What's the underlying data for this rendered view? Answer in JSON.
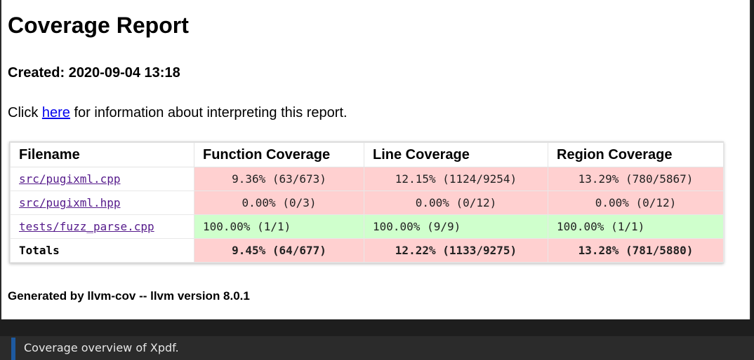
{
  "report": {
    "title": "Coverage Report",
    "created": "Created: 2020-09-04 13:18",
    "info_prefix": "Click ",
    "info_link": "here",
    "info_suffix": " for information about interpreting this report.",
    "footer": "Generated by llvm-cov -- llvm version 8.0.1"
  },
  "table": {
    "headers": [
      "Filename",
      "Function Coverage",
      "Line Coverage",
      "Region Coverage"
    ],
    "rows": [
      {
        "file": "src/pugixml.cpp",
        "function": "9.36% (63/673)",
        "line": "12.15% (1124/9254)",
        "region": "13.29% (780/5867)",
        "status": "low"
      },
      {
        "file": "src/pugixml.hpp",
        "function": "0.00% (0/3)",
        "line": "0.00% (0/12)",
        "region": "0.00% (0/12)",
        "status": "low"
      },
      {
        "file": "tests/fuzz_parse.cpp",
        "function": "100.00% (1/1)",
        "line": "100.00% (9/9)",
        "region": "100.00% (1/1)",
        "status": "full"
      }
    ],
    "totals": {
      "label": "Totals",
      "function": "9.45% (64/677)",
      "line": "12.22% (1133/9275)",
      "region": "13.28% (781/5880)"
    }
  },
  "colors": {
    "low_coverage": "#ffd0d0",
    "full_coverage": "#cfffcc",
    "link": "#0000ee",
    "visited_link": "#551a8b"
  },
  "caption": {
    "text": "Coverage overview of Xpdf."
  }
}
